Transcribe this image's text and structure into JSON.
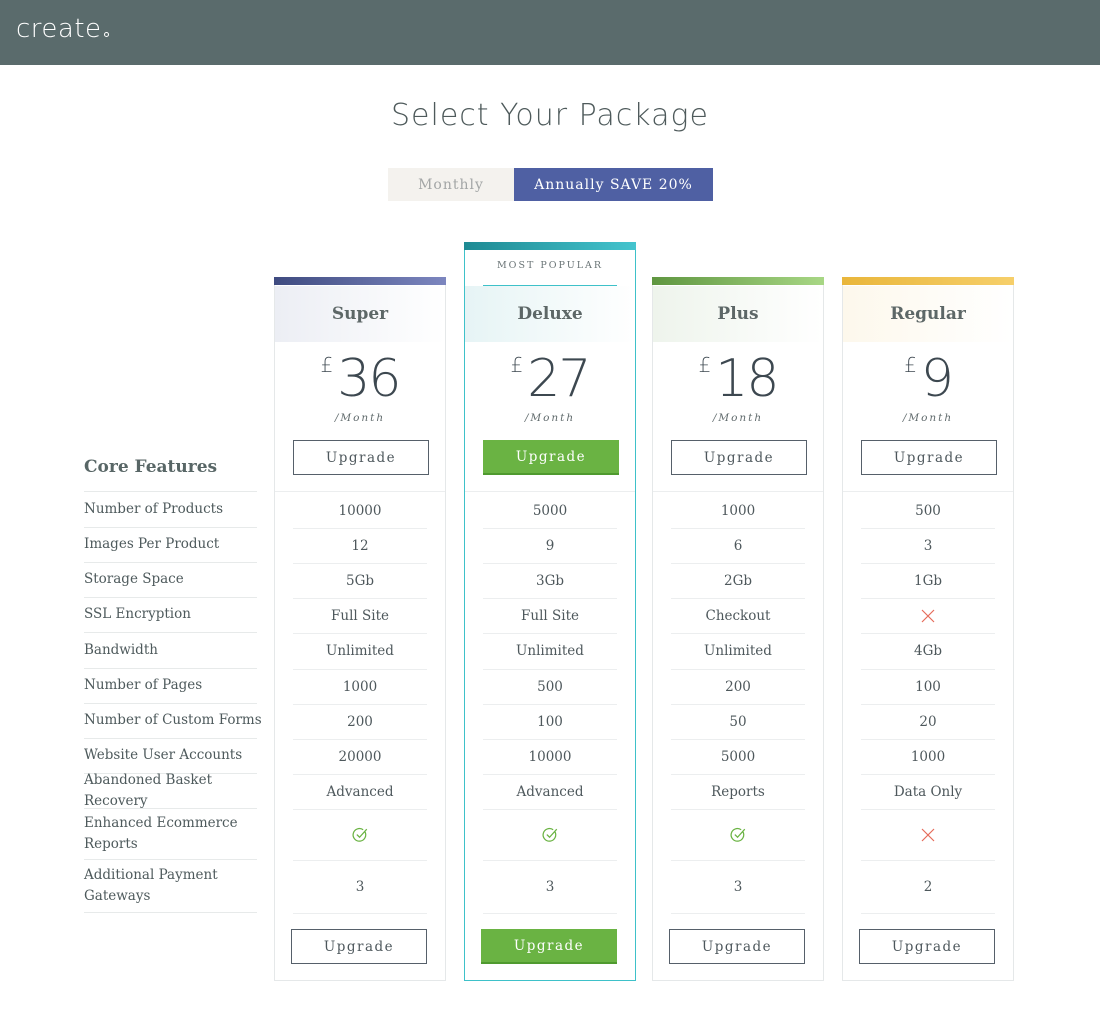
{
  "brand": {
    "logo": "create"
  },
  "page": {
    "title": "Select Your Package"
  },
  "billing": {
    "monthly": "Monthly",
    "annual": "Annually SAVE 20%",
    "selected": "annual"
  },
  "features": {
    "title": "Core Features",
    "items": [
      "Number of Products",
      "Images Per Product",
      "Storage Space",
      "SSL Encryption",
      "Bandwidth",
      "Number of Pages",
      "Number of Custom Forms",
      "Website User Accounts",
      "Abandoned Basket Recovery",
      "Enhanced Ecommerce Reports",
      "Additional Payment Gateways"
    ]
  },
  "plans": [
    {
      "name": "Super",
      "currency": "£",
      "price": "36",
      "period": "/Month",
      "button": "Upgrade",
      "popular": false,
      "stripe": [
        "#3f4b80",
        "#7c86bf"
      ],
      "head_bg": "#eceef4",
      "values": [
        "10000",
        "12",
        "5Gb",
        "Full Site",
        "Unlimited",
        "1000",
        "200",
        "20000",
        "Advanced",
        "check",
        "3"
      ]
    },
    {
      "name": "Deluxe",
      "currency": "£",
      "price": "27",
      "period": "/Month",
      "button": "Upgrade",
      "popular": true,
      "popular_label": "MOST POPULAR",
      "stripe": [
        "#1e8a93",
        "#44c4ce"
      ],
      "head_bg": "#e6f4f5",
      "values": [
        "5000",
        "9",
        "3Gb",
        "Full Site",
        "Unlimited",
        "500",
        "100",
        "10000",
        "Advanced",
        "check",
        "3"
      ]
    },
    {
      "name": "Plus",
      "currency": "£",
      "price": "18",
      "period": "/Month",
      "button": "Upgrade",
      "popular": false,
      "stripe": [
        "#5f9640",
        "#a8d785"
      ],
      "head_bg": "#eef4ec",
      "values": [
        "1000",
        "6",
        "2Gb",
        "Checkout",
        "Unlimited",
        "200",
        "50",
        "5000",
        "Reports",
        "check",
        "3"
      ]
    },
    {
      "name": "Regular",
      "currency": "£",
      "price": "9",
      "period": "/Month",
      "button": "Upgrade",
      "popular": false,
      "stripe": [
        "#e9b63b",
        "#f6cf6a"
      ],
      "head_bg": "#fdf8ec",
      "values": [
        "500",
        "3",
        "1Gb",
        "cross",
        "4Gb",
        "100",
        "20",
        "1000",
        "Data Only",
        "cross",
        "2"
      ]
    }
  ],
  "colors": {
    "accent": "#4f60a3",
    "green": "#6ab343",
    "teal": "#3ec1c9",
    "check": "#6ab343",
    "cross": "#e56b5b"
  }
}
